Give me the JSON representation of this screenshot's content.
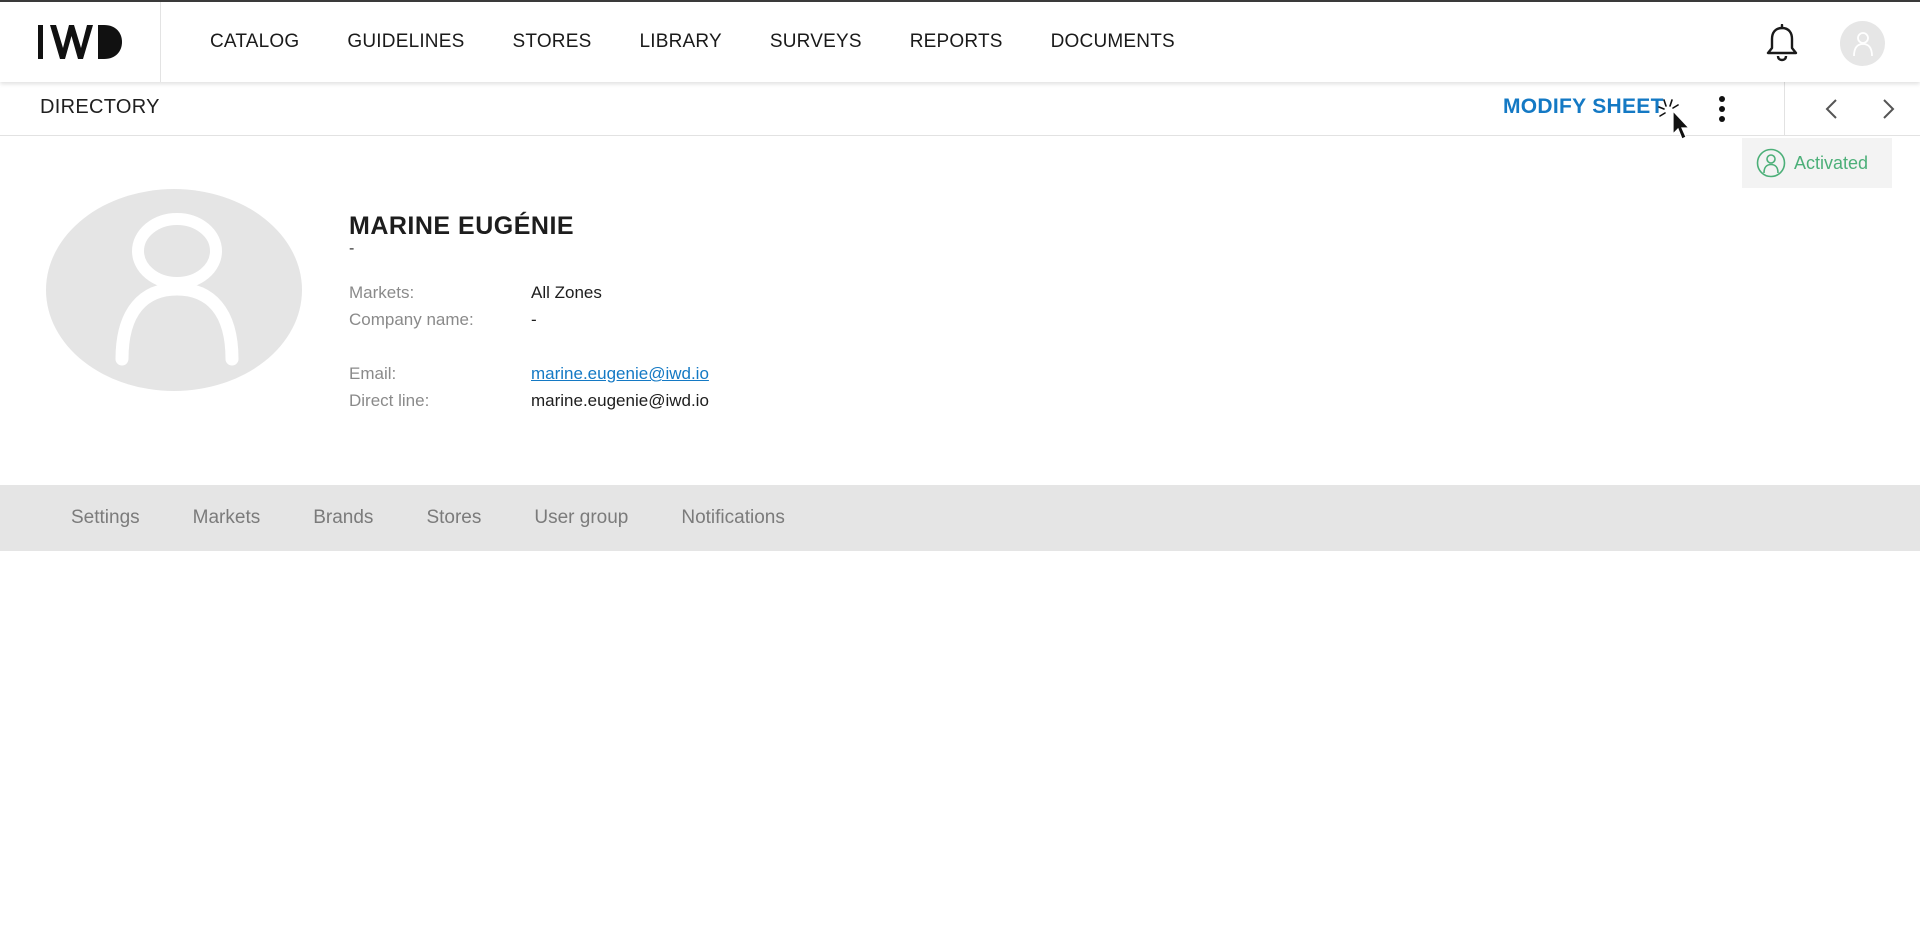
{
  "header": {
    "logo_text": "IWD",
    "nav": [
      {
        "label": "CATALOG"
      },
      {
        "label": "GUIDELINES"
      },
      {
        "label": "STORES"
      },
      {
        "label": "LIBRARY"
      },
      {
        "label": "SURVEYS"
      },
      {
        "label": "REPORTS"
      },
      {
        "label": "DOCUMENTS"
      }
    ],
    "notifications_icon": "bell-icon",
    "user_icon": "user-avatar-icon"
  },
  "subheader": {
    "title": "DIRECTORY",
    "modify_label": "MODIFY SHEET",
    "more_icon": "kebab-menu-icon",
    "prev_icon": "chevron-left-icon",
    "next_icon": "chevron-right-icon"
  },
  "status": {
    "label": "Activated",
    "color": "#4caf78"
  },
  "profile": {
    "name": "MARINE EUGÉNIE",
    "subtitle": "-",
    "fields": [
      {
        "label": "Markets:",
        "value": "All Zones"
      },
      {
        "label": "Company name:",
        "value": "-"
      },
      {
        "label": "Email:",
        "value": "marine.eugenie@iwd.io"
      },
      {
        "label": "Direct line:",
        "value": "marine.eugenie@iwd.io"
      }
    ]
  },
  "tabs": [
    {
      "label": "Settings"
    },
    {
      "label": "Markets"
    },
    {
      "label": "Brands"
    },
    {
      "label": "Stores"
    },
    {
      "label": "User group"
    },
    {
      "label": "Notifications"
    }
  ],
  "colors": {
    "accent": "#1479c4",
    "tabs_bg": "#e5e5e5"
  }
}
